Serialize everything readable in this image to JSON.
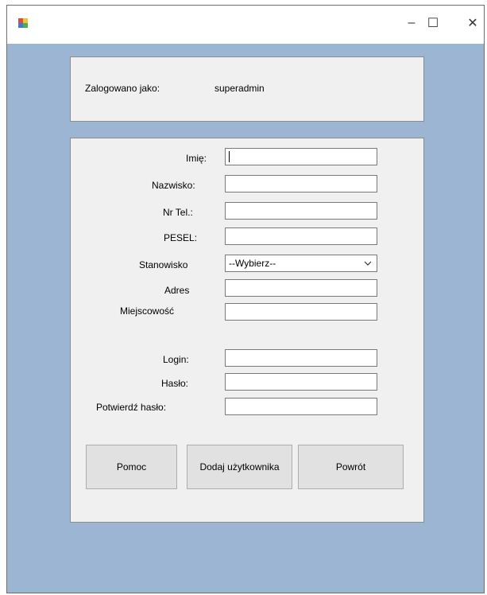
{
  "window": {
    "minimize": "–",
    "maximize": "☐",
    "close": "✕",
    "icon": "app-icon"
  },
  "header": {
    "logged_label": "Zalogowano jako:",
    "user": "superadmin"
  },
  "form": {
    "imie_label": "Imię:",
    "nazwisko_label": "Nazwisko:",
    "tel_label": "Nr Tel.:",
    "pesel_label": "PESEL:",
    "stanowisko_label": "Stanowisko",
    "stanowisko_value": "--Wybierz--",
    "adres_label": "Adres",
    "miejscowosc_label": "Miejscowość",
    "login_label": "Login:",
    "haslo_label": "Hasło:",
    "potwierdz_label": "Potwierdź hasło:"
  },
  "buttons": {
    "help": "Pomoc",
    "add_user": "Dodaj użytkownika",
    "back": "Powrót"
  }
}
